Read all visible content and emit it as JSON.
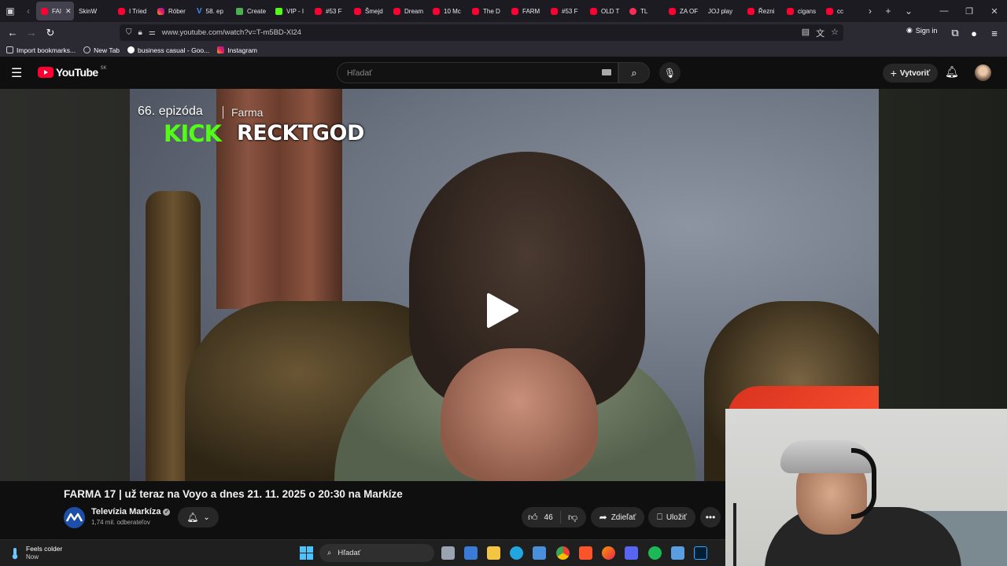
{
  "browser": {
    "tabs": [
      {
        "label": "FAI",
        "icon": "youtube",
        "active": true
      },
      {
        "label": "SkinW",
        "icon": "none"
      },
      {
        "label": "I Tried",
        "icon": "youtube"
      },
      {
        "label": "Róber",
        "icon": "instagram"
      },
      {
        "label": "58. ep",
        "icon": "v"
      },
      {
        "label": "Create",
        "icon": "c"
      },
      {
        "label": "VIP - I",
        "icon": "kick"
      },
      {
        "label": "#53 F",
        "icon": "youtube"
      },
      {
        "label": "Šmejd",
        "icon": "youtube"
      },
      {
        "label": "Dream",
        "icon": "youtube"
      },
      {
        "label": "10 Mc",
        "icon": "youtube"
      },
      {
        "label": "The D",
        "icon": "youtube"
      },
      {
        "label": "FARM",
        "icon": "youtube"
      },
      {
        "label": "#53 F",
        "icon": "youtube"
      },
      {
        "label": "OLD T",
        "icon": "youtube"
      },
      {
        "label": "TL",
        "icon": "tiktok"
      },
      {
        "label": "ZA OF",
        "icon": "youtube"
      },
      {
        "label": "JOJ play",
        "icon": "none"
      },
      {
        "label": "Řezni",
        "icon": "youtube"
      },
      {
        "label": "cigans",
        "icon": "youtube"
      },
      {
        "label": "cc",
        "icon": "youtube"
      }
    ],
    "url": "www.youtube.com/watch?v=T-m5BD-Xl24",
    "signin_label": "Sign in",
    "bookmarks": [
      {
        "label": "Import bookmarks...",
        "icon": "import-icon"
      },
      {
        "label": "New Tab",
        "icon": "globe-icon"
      },
      {
        "label": "business casual - Goo...",
        "icon": "google-icon"
      },
      {
        "label": "Instagram",
        "icon": "instagram-icon"
      }
    ]
  },
  "youtube": {
    "logo_text": "YouTube",
    "country_code": "SK",
    "search_placeholder": "Hľadať",
    "create_label": "Vytvoriť"
  },
  "video": {
    "episode": "66. epizóda",
    "show": "Farma",
    "overlay_brand": "KICK",
    "overlay_user": "RECKTGOD",
    "title": "FARMA 17 | už teraz na Voyo a dnes 21. 11. 2025 o 20:30 na Markíze",
    "channel_name": "Televízia Markíza",
    "subscribers": "1,74 mil. odberateľov",
    "likes": "46",
    "share_label": "Zdieľať",
    "save_label": "Uložiť"
  },
  "taskbar": {
    "weather_label": "Feels colder",
    "weather_sub": "Now",
    "search_label": "Hľadať"
  },
  "colors": {
    "youtube_red": "#ff0033",
    "kick_green": "#53fc18",
    "background": "#0f0f0f"
  }
}
